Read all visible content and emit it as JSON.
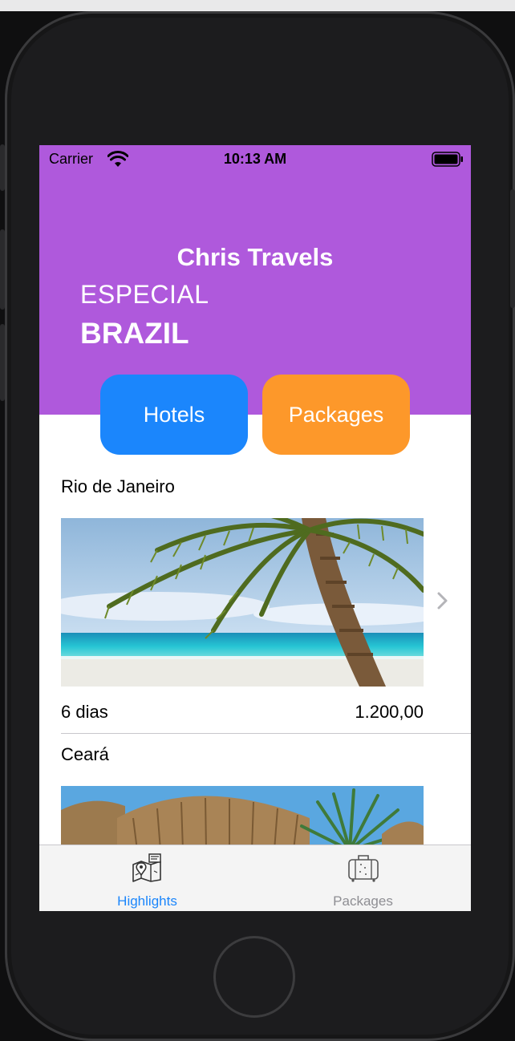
{
  "status_bar": {
    "carrier": "Carrier",
    "time": "10:13 AM"
  },
  "header": {
    "app_title": "Chris Travels",
    "subtitle": "ESPECIAL",
    "country": "BRAZIL",
    "background_color": "#af59dc"
  },
  "buttons": {
    "hotels": {
      "label": "Hotels",
      "color": "#1b86fc"
    },
    "packages": {
      "label": "Packages",
      "color": "#fd982a"
    }
  },
  "destinations": [
    {
      "city": "Rio de Janeiro",
      "duration": "6 dias",
      "price": "1.200,00",
      "image": "palm-beach-photo"
    },
    {
      "city": "Ceará",
      "image": "thatched-huts-photo"
    }
  ],
  "tab_bar": {
    "tabs": [
      {
        "label": "Highlights",
        "icon": "map-icon",
        "active": true
      },
      {
        "label": "Packages",
        "icon": "suitcase-icon",
        "active": false
      }
    ],
    "active_color": "#1b86fc",
    "inactive_color": "#8e8e93"
  }
}
